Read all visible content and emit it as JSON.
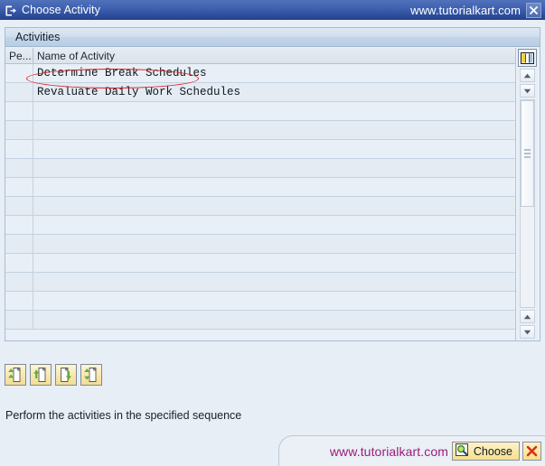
{
  "titlebar": {
    "icon": "exit-box-icon",
    "title": "Choose Activity",
    "brand": "www.tutorialkart.com",
    "close_icon": "close-x-icon"
  },
  "panel": {
    "header": "Activities"
  },
  "grid": {
    "columns": [
      "Pe...",
      "Name of Activity"
    ],
    "rows": [
      {
        "period": "",
        "activity": "Determine Break Schedules"
      },
      {
        "period": "",
        "activity": "Revaluate Daily Work Schedules"
      },
      {
        "period": "",
        "activity": ""
      },
      {
        "period": "",
        "activity": ""
      },
      {
        "period": "",
        "activity": ""
      },
      {
        "period": "",
        "activity": ""
      },
      {
        "period": "",
        "activity": ""
      },
      {
        "period": "",
        "activity": ""
      },
      {
        "period": "",
        "activity": ""
      },
      {
        "period": "",
        "activity": ""
      },
      {
        "period": "",
        "activity": ""
      },
      {
        "period": "",
        "activity": ""
      },
      {
        "period": "",
        "activity": ""
      },
      {
        "period": "",
        "activity": ""
      }
    ],
    "column_config_icon": "column-settings-icon",
    "scroll_up_icon": "scroll-up-arrow-icon",
    "scroll_down_icon": "scroll-down-arrow-icon"
  },
  "annotation": {
    "shape": "red-ellipse-highlight",
    "target": "Determine Break Schedules",
    "color": "#e01b1b"
  },
  "toolbar": {
    "buttons": [
      {
        "name": "first-activity-button",
        "icon": "document-first-icon",
        "title": "First"
      },
      {
        "name": "previous-activity-button",
        "icon": "document-up-icon",
        "title": "Previous"
      },
      {
        "name": "next-activity-button",
        "icon": "document-down-icon",
        "title": "Next"
      },
      {
        "name": "last-activity-button",
        "icon": "document-last-icon",
        "title": "Last"
      }
    ]
  },
  "status": {
    "message": "Perform the activities in the specified sequence"
  },
  "footer": {
    "brand": "www.tutorialkart.com",
    "choose_label": "Choose",
    "choose_icon": "magnifier-select-icon",
    "cancel_icon": "cancel-x-icon"
  },
  "colors": {
    "title_bar": "#2e4e9c",
    "panel_bg": "#e8eef5",
    "accent_red": "#e01b1b",
    "brand_purple": "#9b1b7a",
    "button_yellow": "#f6df8d"
  }
}
